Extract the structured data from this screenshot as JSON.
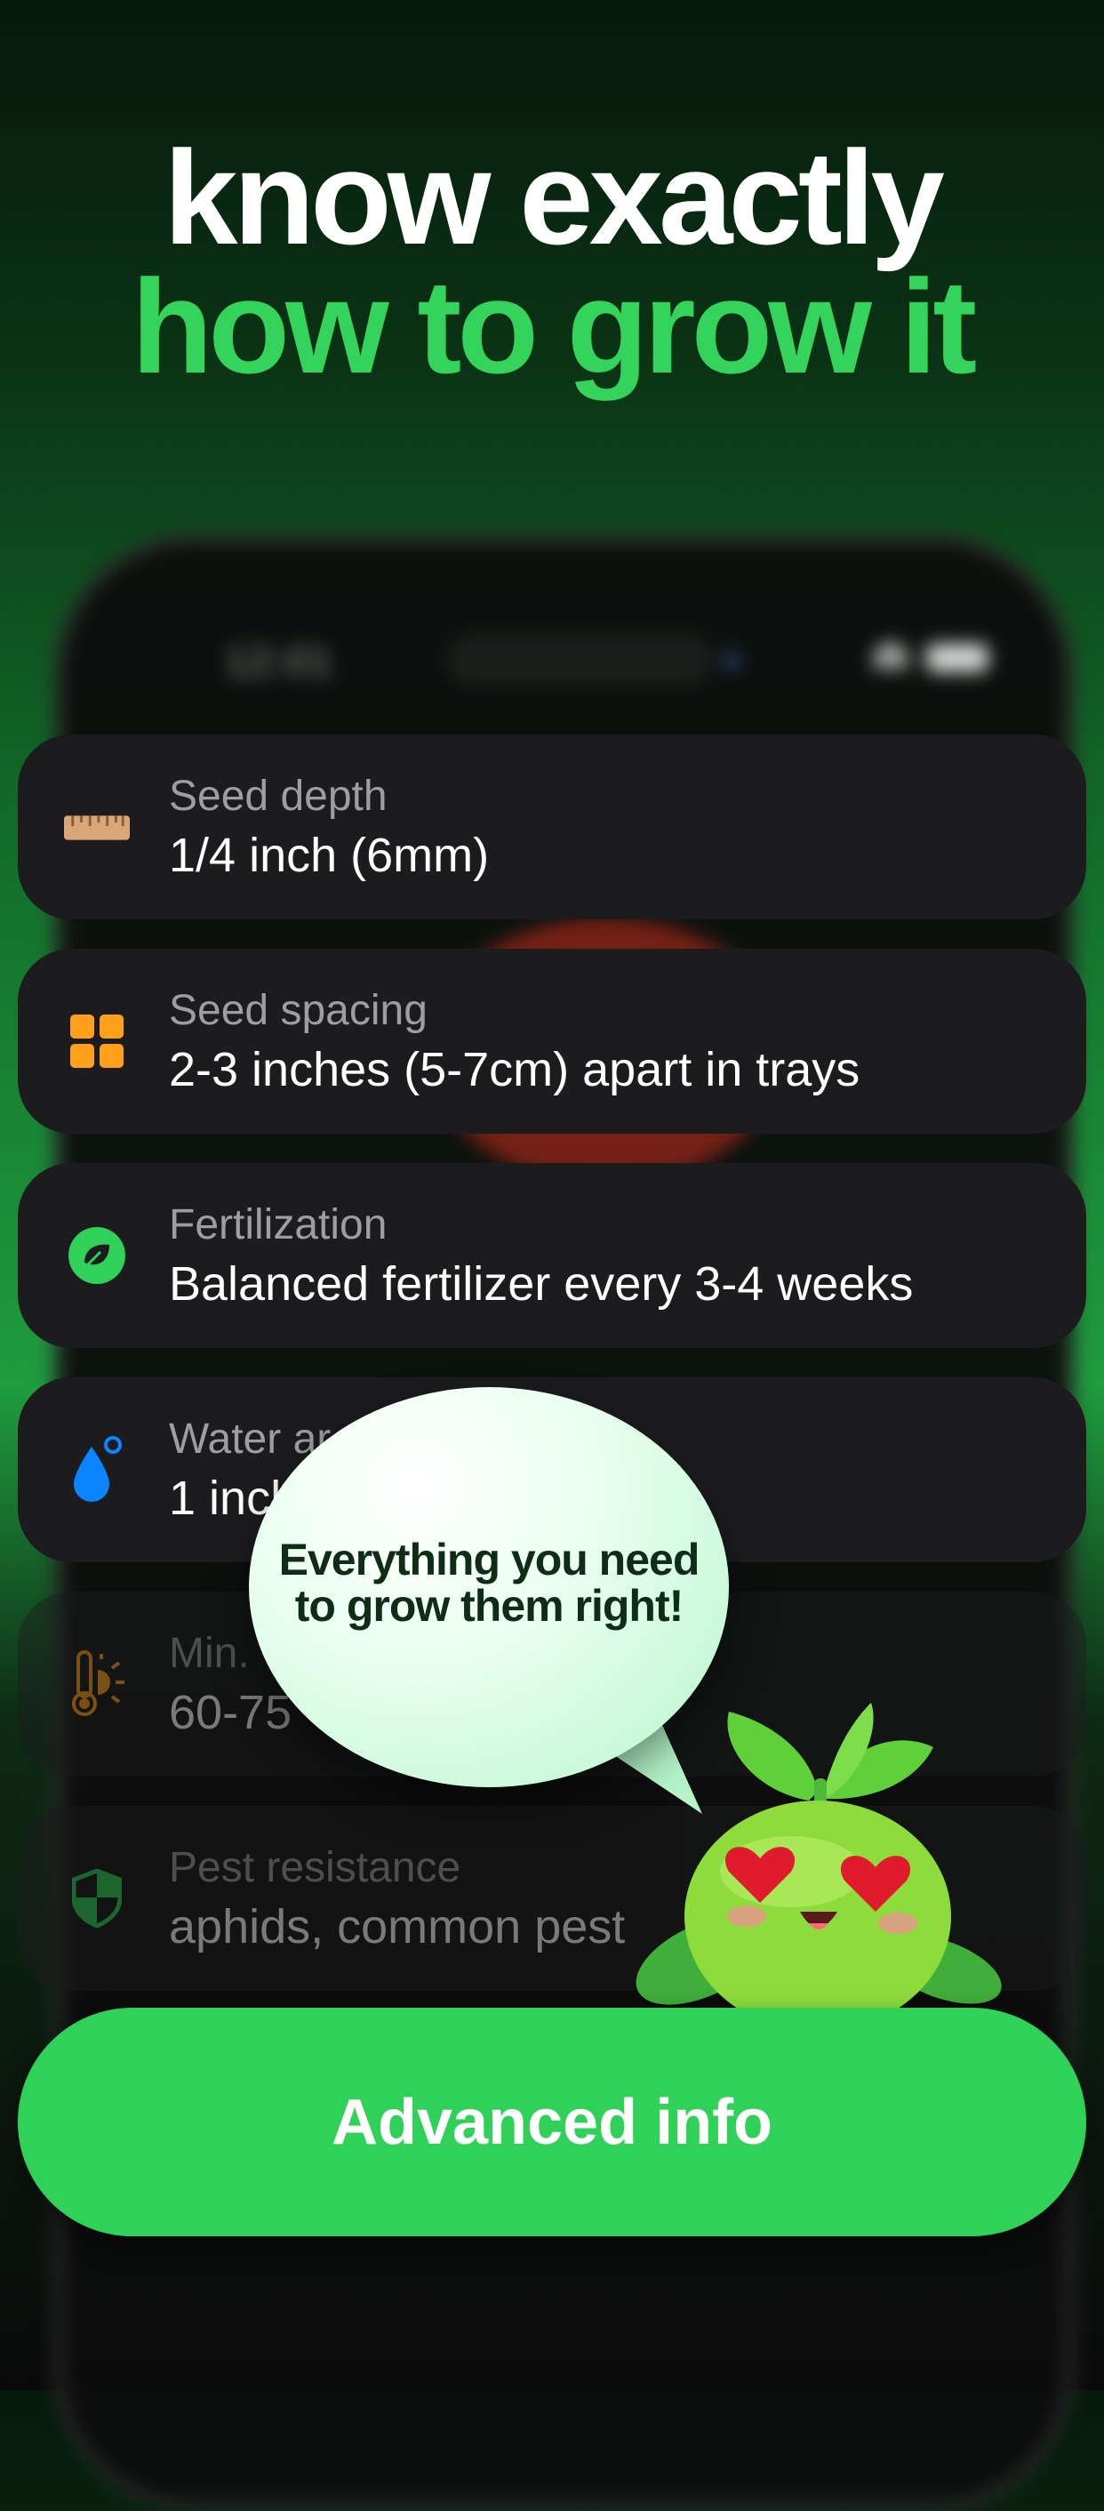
{
  "headline": {
    "line1": "know exactly",
    "line2": "how to grow it"
  },
  "phone_status": {
    "time": "12:01"
  },
  "cards": [
    {
      "icon": "ruler-icon",
      "label": "Seed depth",
      "value": "1/4 inch (6mm)"
    },
    {
      "icon": "grid-icon",
      "label": "Seed spacing",
      "value": "2-3 inches (5-7cm) apart in trays"
    },
    {
      "icon": "leaf-icon",
      "label": "Fertilization",
      "value": "Balanced fertilizer every 3-4 weeks"
    },
    {
      "icon": "water-drop-icon",
      "label": "Water ar",
      "value": "1 inch"
    },
    {
      "icon": "thermometer-sun-icon",
      "label": "Min.",
      "value": "60-75"
    },
    {
      "icon": "shield-icon",
      "label": "Pest resistance",
      "value": "aphids, common pest"
    }
  ],
  "speech_bubble": {
    "text": "Everything you need to grow them right!"
  },
  "cta": {
    "label": "Advanced info"
  },
  "colors": {
    "accent": "#30d158",
    "headline_green": "#34d35c",
    "card_bg": "#1c1c1e"
  }
}
